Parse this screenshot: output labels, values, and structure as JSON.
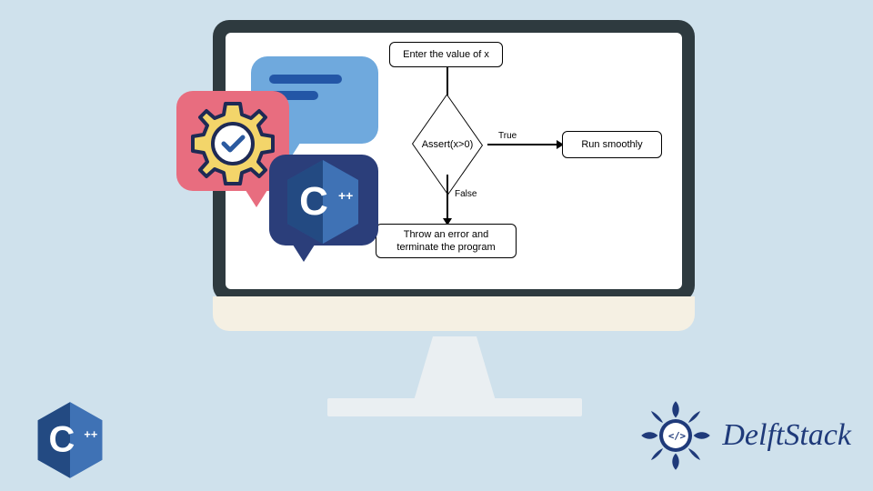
{
  "flowchart": {
    "start": "Enter the value of x",
    "decision": "Assert(x>0)",
    "true_label": "True",
    "false_label": "False",
    "true_result": "Run smoothly",
    "false_result": "Throw an error and terminate the program"
  },
  "logo": {
    "brand": "DelftStack",
    "cpp_symbol": "C",
    "cpp_plus": "++"
  },
  "colors": {
    "page_bg": "#cfe1ec",
    "monitor_frame": "#2e3a3f",
    "bubble_blue": "#6fa9dd",
    "bubble_pink": "#e86d7f",
    "bubble_navy": "#2b3e7a",
    "gear": "#f3d56a",
    "gear_outline": "#1e2a55",
    "cpp_blue": "#2b5aa0",
    "delft_blue": "#1f3a7a"
  },
  "chart_data": {
    "type": "flowchart",
    "nodes": [
      {
        "id": "start",
        "shape": "rect",
        "label": "Enter the value of x"
      },
      {
        "id": "assert",
        "shape": "diamond",
        "label": "Assert(x>0)"
      },
      {
        "id": "run",
        "shape": "rect",
        "label": "Run smoothly"
      },
      {
        "id": "error",
        "shape": "rect",
        "label": "Throw an error and terminate the program"
      }
    ],
    "edges": [
      {
        "from": "start",
        "to": "assert",
        "label": ""
      },
      {
        "from": "assert",
        "to": "run",
        "label": "True"
      },
      {
        "from": "assert",
        "to": "error",
        "label": "False"
      }
    ]
  }
}
